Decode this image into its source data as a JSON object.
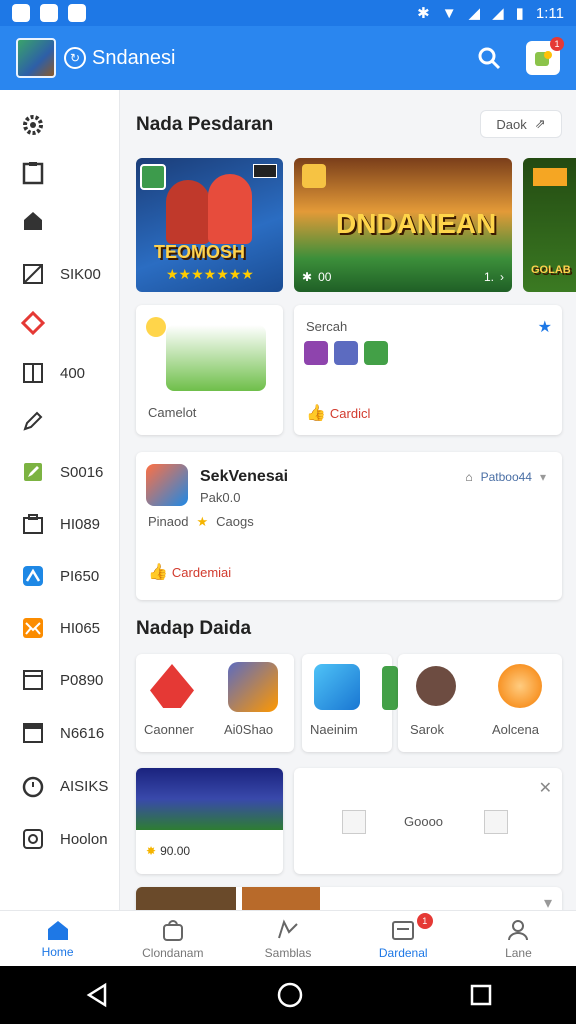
{
  "status": {
    "time": "1:11"
  },
  "appbar": {
    "title": "Sndanesi",
    "brand_glyph": "↻",
    "notif_count": "1"
  },
  "sidebar": {
    "items": [
      {
        "icon": "gear-icon",
        "label": ""
      },
      {
        "icon": "clipboard-icon",
        "label": ""
      },
      {
        "icon": "home-icon",
        "label": ""
      },
      {
        "icon": "crop-icon",
        "label": "SIK00"
      },
      {
        "icon": "diamond-icon",
        "label": ""
      },
      {
        "icon": "panel-icon",
        "label": "400"
      },
      {
        "icon": "pencil-icon",
        "label": ""
      },
      {
        "icon": "edit-icon",
        "label": "S0016"
      },
      {
        "icon": "briefcase-icon",
        "label": "HI089"
      },
      {
        "icon": "person-icon",
        "label": "PI650"
      },
      {
        "icon": "mail-icon",
        "label": "HI065"
      },
      {
        "icon": "card-icon",
        "label": "P0890"
      },
      {
        "icon": "browser-icon",
        "label": "N6616"
      },
      {
        "icon": "timer-icon",
        "label": "AISIKS"
      },
      {
        "icon": "id-icon",
        "label": "Hoolon"
      }
    ]
  },
  "section1": {
    "title": "Nada Pesdaran",
    "see_all": "Daok",
    "banners": [
      {
        "text": "TEOMOSH"
      },
      {
        "text": "DNDANEAN",
        "counter": "00",
        "page": "1."
      },
      {
        "text": "GOLAB"
      }
    ],
    "card_left": {
      "label": "Camelot"
    },
    "card_right": {
      "title": "Sercah",
      "tag": "Cardicl"
    }
  },
  "feature": {
    "title": "SekVenesai",
    "subtitle": "Pak0.0",
    "meta1": "Pinaod",
    "meta2": "Caogs",
    "tag": "Cardemiai",
    "action": "Patboo44"
  },
  "section2": {
    "title": "Nadap Daida",
    "apps_left": [
      {
        "name": "Caonner"
      },
      {
        "name": "Ai0Shao"
      }
    ],
    "app_mid": {
      "name": "Naeinim"
    },
    "apps_right": [
      {
        "name": "Sarok"
      },
      {
        "name": "Aolcena"
      }
    ],
    "promo": {
      "price": "90.00"
    },
    "panel": {
      "label": "Goooo"
    }
  },
  "bottomnav": {
    "items": [
      {
        "label": "Home",
        "icon": "home-icon"
      },
      {
        "label": "Clondanam",
        "icon": "bag-icon"
      },
      {
        "label": "Samblas",
        "icon": "map-icon"
      },
      {
        "label": "Dardenal",
        "icon": "inbox-icon",
        "badge": "1"
      },
      {
        "label": "Lane",
        "icon": "profile-icon"
      }
    ]
  },
  "colors": {
    "primary": "#2a86ef",
    "statusbar": "#1e78e6",
    "accent_red": "#d23b2e"
  }
}
